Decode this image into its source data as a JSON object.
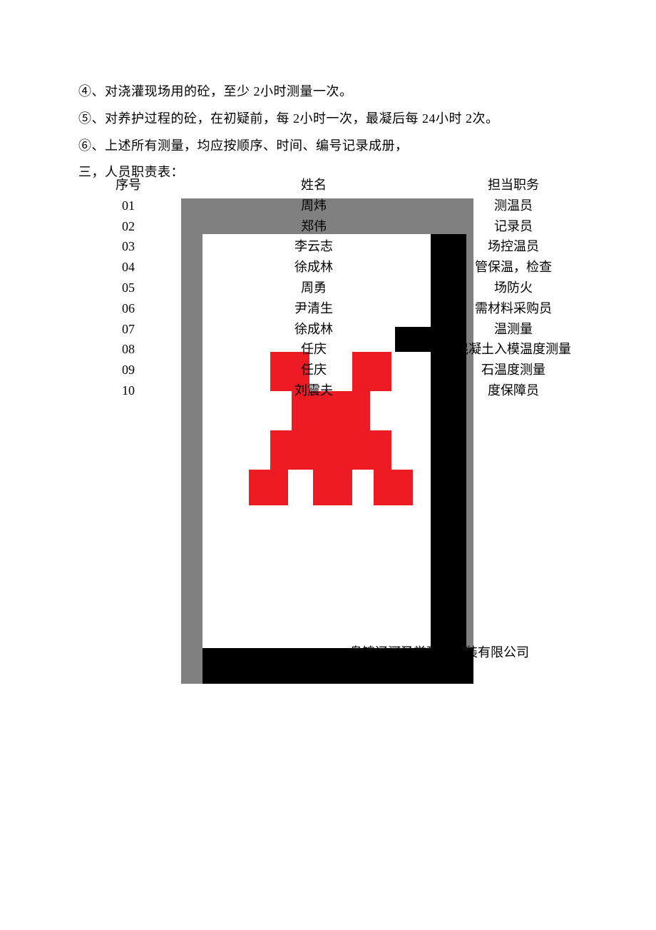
{
  "lines": {
    "l1": "④、对浇灌现场用的砼，至少   2小时测量一次。",
    "l2": "⑤、对养护过程的砼，在初疑前，每   2小时一次，最凝后每   24小时 2次。",
    "l3": "⑥、上述所有测量，均应按顺序、时间、编号记录成册，",
    "l4": "三，人员职责表："
  },
  "tableHeader": {
    "col1": "序号",
    "col2": "姓名",
    "col3": "担当职务"
  },
  "rows": [
    {
      "seq": "01",
      "name": "周炜",
      "role": "测温员"
    },
    {
      "seq": "02",
      "name": "郑伟",
      "role": "记录员"
    },
    {
      "seq": "03",
      "name": "李云志",
      "role": "场控温员"
    },
    {
      "seq": "04",
      "name": "徐成林",
      "role": "管保温，检查"
    },
    {
      "seq": "05",
      "name": "周勇",
      "role": "场防火"
    },
    {
      "seq": "06",
      "name": "尹清生",
      "role": "需材料采购员"
    },
    {
      "seq": "07",
      "name": "徐成林",
      "role": "温测量"
    },
    {
      "seq": "08",
      "name": "任庆",
      "role": "混凝土入模温度测量"
    },
    {
      "seq": "09",
      "name": "任庆",
      "role": "石温度测量"
    },
    {
      "seq": "10",
      "name": "刘震夫",
      "role": "度保障员"
    }
  ],
  "footer": "盘锦辽河圣誉建筑安装有限公司"
}
